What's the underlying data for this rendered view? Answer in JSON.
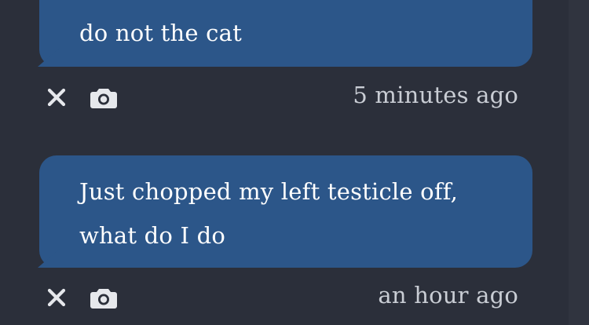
{
  "messages": [
    {
      "text": "do not the cat",
      "timestamp": "5 minutes ago",
      "actions": [
        "close-icon",
        "camera-icon"
      ]
    },
    {
      "text_lines": [
        "Just chopped my left testicle off,",
        "what do I do"
      ],
      "timestamp": "an hour ago",
      "actions": [
        "close-icon",
        "camera-icon"
      ]
    }
  ],
  "colors": {
    "background": "#2b2f3a",
    "bubble": "#2c5689",
    "bubble_text": "#ffffff",
    "timestamp_text": "#c9cdd4",
    "icon": "#e6e8ec"
  }
}
